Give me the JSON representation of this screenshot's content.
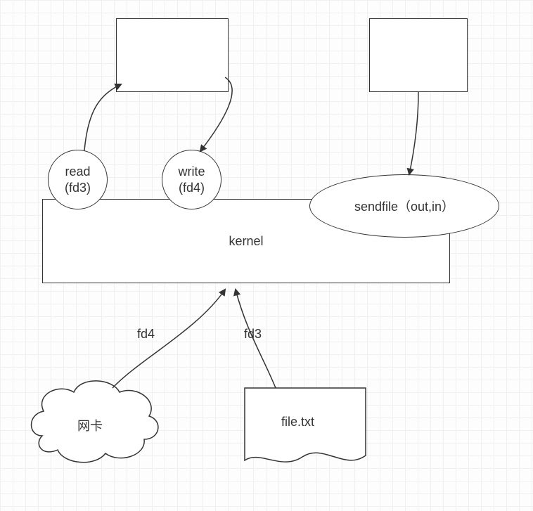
{
  "nodes": {
    "kernel": "kernel",
    "read": "read\n(fd3)",
    "write": "write\n(fd4)",
    "sendfile": "sendfile（out,in）",
    "nic": "网卡",
    "file": "file.txt"
  },
  "edges": {
    "fd4": "fd4",
    "fd3": "fd3"
  }
}
